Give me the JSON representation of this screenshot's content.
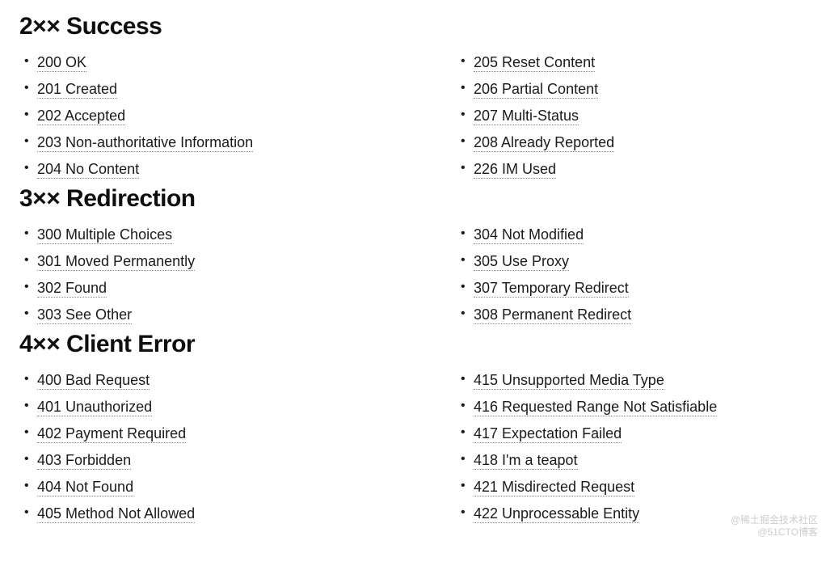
{
  "sections": [
    {
      "heading": "2×× Success",
      "left": [
        "200 OK",
        "201 Created",
        "202 Accepted",
        "203 Non-authoritative Information",
        "204 No Content"
      ],
      "right": [
        "205 Reset Content",
        "206 Partial Content",
        "207 Multi-Status",
        "208 Already Reported",
        "226 IM Used"
      ]
    },
    {
      "heading": "3×× Redirection",
      "left": [
        "300 Multiple Choices",
        "301 Moved Permanently",
        "302 Found",
        "303 See Other"
      ],
      "right": [
        "304 Not Modified",
        "305 Use Proxy",
        "307 Temporary Redirect",
        "308 Permanent Redirect"
      ]
    },
    {
      "heading": "4×× Client Error",
      "left": [
        "400 Bad Request",
        "401 Unauthorized",
        "402 Payment Required",
        "403 Forbidden",
        "404 Not Found",
        "405 Method Not Allowed"
      ],
      "right": [
        "415 Unsupported Media Type",
        "416 Requested Range Not Satisfiable",
        "417 Expectation Failed",
        "418 I'm a teapot",
        "421 Misdirected Request",
        "422 Unprocessable Entity"
      ]
    }
  ],
  "watermark": {
    "line1": "@稀土掘金技术社区",
    "line2": "@51CTO博客"
  }
}
